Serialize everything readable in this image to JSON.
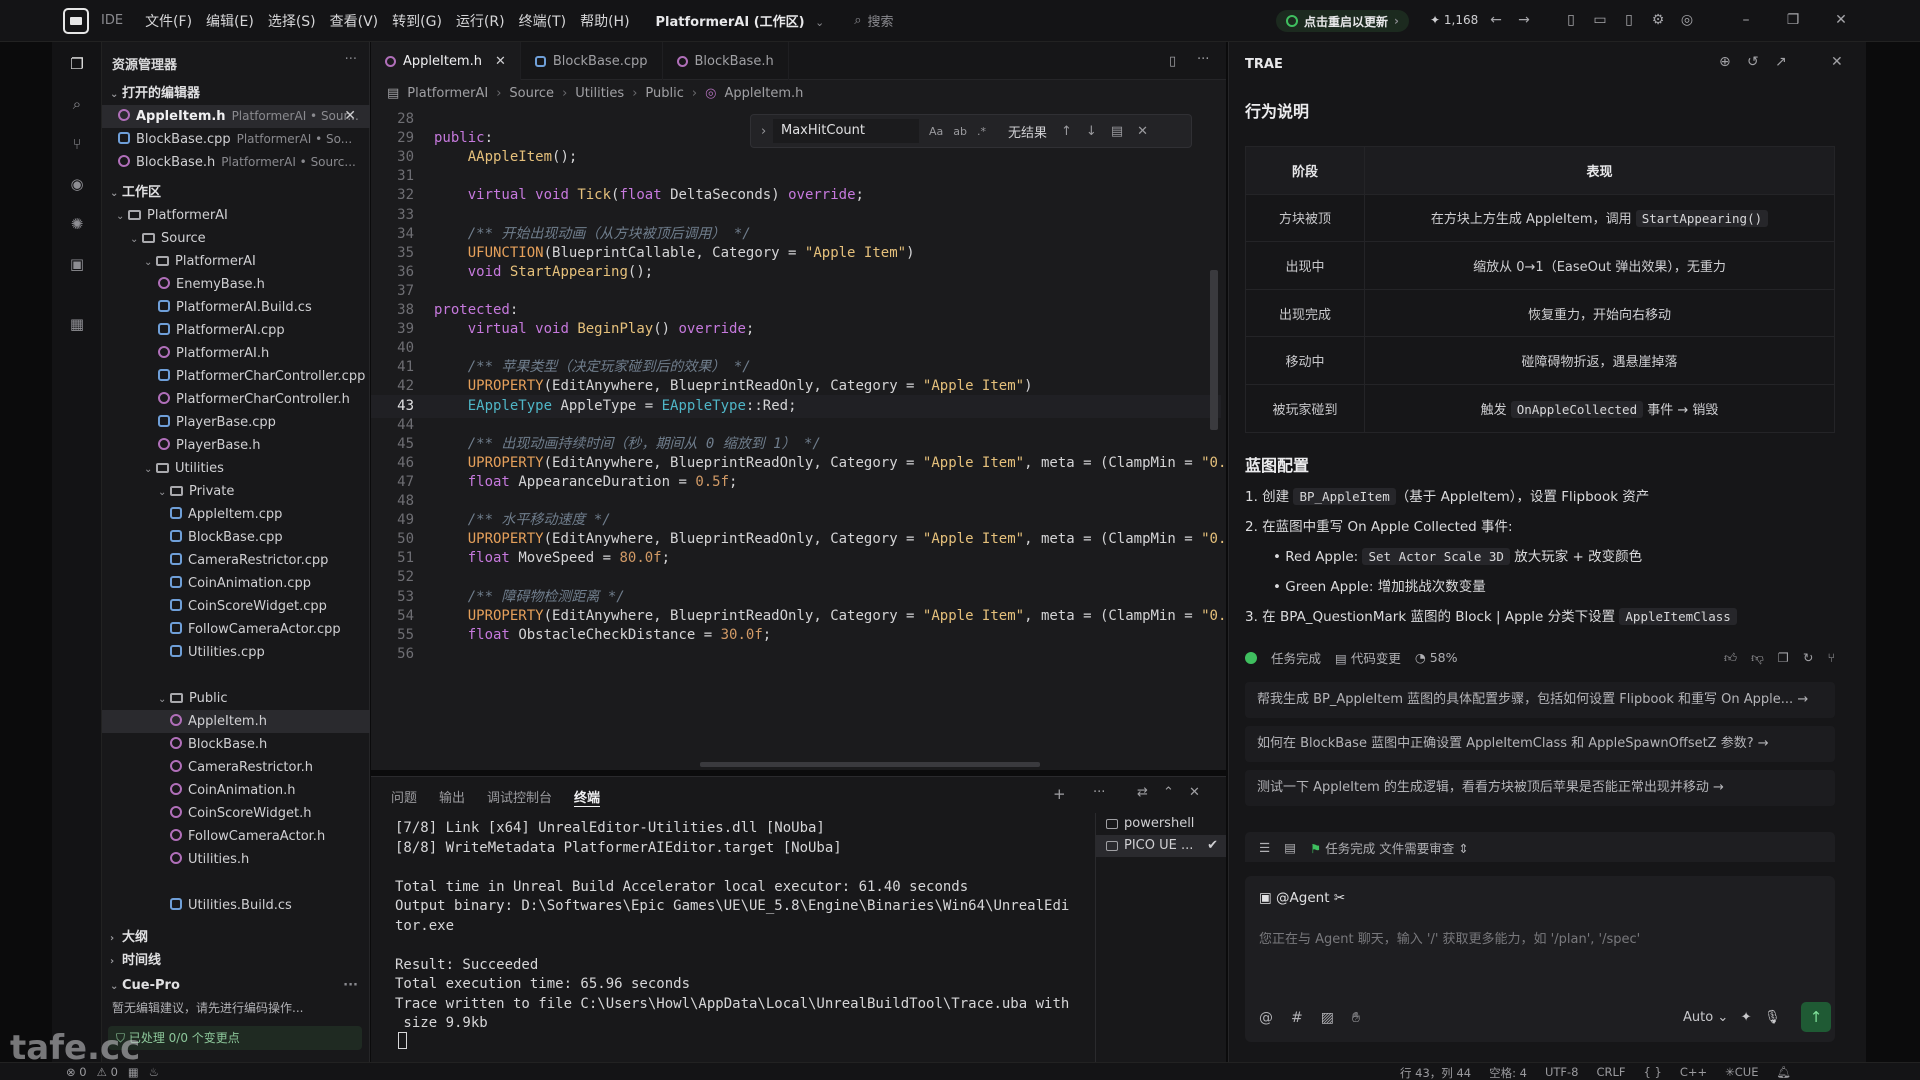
{
  "titlebar": {
    "ide_label": "IDE",
    "menu": [
      "文件(F)",
      "编辑(E)",
      "选择(S)",
      "查看(V)",
      "转到(G)",
      "运行(R)",
      "终端(T)",
      "帮助(H)"
    ],
    "workspace": "PlatformerAI",
    "workspace_suffix": "(工作区)",
    "search": "搜索",
    "update": "点击重启以更新",
    "star_count": "1,168"
  },
  "explorer": {
    "title": "资源管理器",
    "open_editors_label": "打开的编辑器",
    "open_editors": [
      {
        "name": "AppleItem.h",
        "path": "PlatformerAI • Sour..."
      },
      {
        "name": "BlockBase.cpp",
        "path": "PlatformerAI • So..."
      },
      {
        "name": "BlockBase.h",
        "path": "PlatformerAI • Sourc..."
      }
    ],
    "workspace_label": "工作区",
    "tree": {
      "root": "PlatformerAI",
      "source": "Source",
      "module": "PlatformerAI",
      "module_files": [
        "EnemyBase.h",
        "PlatformerAI.Build.cs",
        "PlatformerAI.cpp",
        "PlatformerAI.h",
        "PlatformerCharController.cpp",
        "PlatformerCharController.h",
        "PlayerBase.cpp",
        "PlayerBase.h"
      ],
      "utilities": "Utilities",
      "private": "Private",
      "private_files": [
        "AppleItem.cpp",
        "BlockBase.cpp",
        "CameraRestrictor.cpp",
        "CoinAnimation.cpp",
        "CoinScoreWidget.cpp",
        "FollowCameraActor.cpp",
        "Utilities.cpp"
      ],
      "public": "Public",
      "public_files": [
        "AppleItem.h",
        "BlockBase.h",
        "CameraRestrictor.h",
        "CoinAnimation.h",
        "CoinScoreWidget.h",
        "FollowCameraActor.h",
        "Utilities.h"
      ],
      "utilities_build": "Utilities.Build.cs"
    },
    "outline_label": "大纲",
    "timeline_label": "时间线",
    "cue_label": "Cue-Pro",
    "cue_hint": "暂无编辑建议，请先进行编码操作...",
    "cue_status": "已处理 0/0 个变更点"
  },
  "editor": {
    "tabs": [
      "AppleItem.h",
      "BlockBase.cpp",
      "BlockBase.h"
    ],
    "breadcrumb": [
      "PlatformerAI",
      "Source",
      "Utilities",
      "Public",
      "AppleItem.h"
    ],
    "find": {
      "query": "MaxHitCount",
      "opt1": "Aa",
      "opt2": "ab",
      "opt3": ".*",
      "result": "无结果"
    },
    "lines": [
      {
        "n": "28",
        "c": ""
      },
      {
        "n": "29",
        "c": "public:"
      },
      {
        "n": "30",
        "c": "    AAppleItem();"
      },
      {
        "n": "31",
        "c": ""
      },
      {
        "n": "32",
        "c": "    virtual void Tick(float DeltaSeconds) override;"
      },
      {
        "n": "33",
        "c": ""
      },
      {
        "n": "34",
        "c": "    /** 开始出现动画（从方块被顶后调用） */"
      },
      {
        "n": "35",
        "c": "    UFUNCTION(BlueprintCallable, Category = \"Apple Item\")"
      },
      {
        "n": "36",
        "c": "    void StartAppearing();"
      },
      {
        "n": "37",
        "c": ""
      },
      {
        "n": "38",
        "c": "protected:"
      },
      {
        "n": "39",
        "c": "    virtual void BeginPlay() override;"
      },
      {
        "n": "40",
        "c": ""
      },
      {
        "n": "41",
        "c": "    /** 苹果类型（决定玩家碰到后的效果） */"
      },
      {
        "n": "42",
        "c": "    UPROPERTY(EditAnywhere, BlueprintReadOnly, Category = \"Apple Item\")"
      },
      {
        "n": "43",
        "c": "    EAppleType AppleType = EAppleType::Red;"
      },
      {
        "n": "44",
        "c": ""
      },
      {
        "n": "45",
        "c": "    /** 出现动画持续时间（秒，期间从 0 缩放到 1） */"
      },
      {
        "n": "46",
        "c": "    UPROPERTY(EditAnywhere, BlueprintReadOnly, Category = \"Apple Item\", meta = (ClampMin = \"0."
      },
      {
        "n": "47",
        "c": "    float AppearanceDuration = 0.5f;"
      },
      {
        "n": "48",
        "c": ""
      },
      {
        "n": "49",
        "c": "    /** 水平移动速度 */"
      },
      {
        "n": "50",
        "c": "    UPROPERTY(EditAnywhere, BlueprintReadOnly, Category = \"Apple Item\", meta = (ClampMin = \"0."
      },
      {
        "n": "51",
        "c": "    float MoveSpeed = 80.0f;"
      },
      {
        "n": "52",
        "c": ""
      },
      {
        "n": "53",
        "c": "    /** 障碍物检测距离 */"
      },
      {
        "n": "54",
        "c": "    UPROPERTY(EditAnywhere, BlueprintReadOnly, Category = \"Apple Item\", meta = (ClampMin = \"0."
      },
      {
        "n": "55",
        "c": "    float ObstacleCheckDistance = 30.0f;"
      },
      {
        "n": "56",
        "c": ""
      }
    ]
  },
  "panel": {
    "tabs": [
      "问题",
      "输出",
      "调试控制台",
      "终端"
    ],
    "terminal_lines": [
      "[7/8] Link [x64] UnrealEditor-Utilities.dll [NoUba]",
      "[8/8] WriteMetadata PlatformerAIEditor.target [NoUba]",
      "",
      "Total time in Unreal Build Accelerator local executor: 61.40 seconds",
      "Output binary: D:\\Softwares\\Epic Games\\UE\\UE_5.8\\Engine\\Binaries\\Win64\\UnrealEdi",
      "tor.exe",
      "",
      "Result: Succeeded",
      "Total execution time: 65.96 seconds",
      "Trace written to file C:\\Users\\Howl\\AppData\\Local\\UnrealBuildTool\\Trace.uba with",
      " size 9.9kb"
    ],
    "terminals": [
      "powershell",
      "PICO UE ..."
    ]
  },
  "ai": {
    "title": "TRAE",
    "h1": "行为说明",
    "table_headers": [
      "阶段",
      "表现"
    ],
    "table_rows": [
      {
        "stage": "方块被顶",
        "pre": "在方块上方生成 AppleItem，调用 ",
        "code": "StartAppearing()",
        "post": ""
      },
      {
        "stage": "出现中",
        "pre": "缩放从 0→1（EaseOut 弹出效果），无重力",
        "code": "",
        "post": ""
      },
      {
        "stage": "出现完成",
        "pre": "恢复重力，开始向右移动",
        "code": "",
        "post": ""
      },
      {
        "stage": "移动中",
        "pre": "碰障碍物折返，遇悬崖掉落",
        "code": "",
        "post": ""
      },
      {
        "stage": "被玩家碰到",
        "pre": "触发 ",
        "code": "OnAppleCollected",
        "post": " 事件 → 销毁"
      }
    ],
    "h2": "蓝图配置",
    "steps": {
      "s1_pre": "1. 创建 ",
      "s1_code": "BP_AppleItem",
      "s1_post": "（基于 AppleItem），设置 Flipbook 资产",
      "s2": "2. 在蓝图中重写 On Apple Collected 事件:",
      "b1_pre": "• Red Apple: ",
      "b1_code": "Set Actor Scale 3D",
      "b1_post": " 放大玩家 + 改变颜色",
      "b2": "• Green Apple: 增加挑战次数变量",
      "s3_pre": "3. 在 BPA_QuestionMark 蓝图的 Block | Apple 分类下设置 ",
      "s3_code": "AppleItemClass"
    },
    "status": {
      "done": "任务完成",
      "changes": "代码变更",
      "percent": "58%"
    },
    "suggestions": [
      "帮我生成 BP_AppleItem 蓝图的具体配置步骤，包括如何设置 Flipbook 和重写 On Apple...",
      "如何在 BlockBase 蓝图中正确设置 AppleItemClass 和 AppleSpawnOffsetZ 参数?",
      "测试一下 AppleItem 的生成逻辑，看看方块被顶后苹果是否能正常出现并移动"
    ],
    "task_bar": "任务完成 文件需要审查",
    "agent": "@Agent",
    "placeholder": "您正在与 Agent 聊天，输入 '/' 获取更多能力，如 '/plan', '/spec'",
    "mode": "Auto"
  },
  "statusbar": {
    "errors": "0",
    "warnings": "0",
    "position": "行 43，列 44",
    "spaces": "空格: 4",
    "encoding": "UTF-8",
    "eol": "CRLF",
    "lang": "C++",
    "cue": "CUE"
  },
  "watermark": "tafe.cc",
  "colors": {
    "accent_green": "#3fbf5f",
    "keyword": "#c679dd",
    "type": "#4fb6c7",
    "string": "#e5c07b"
  }
}
